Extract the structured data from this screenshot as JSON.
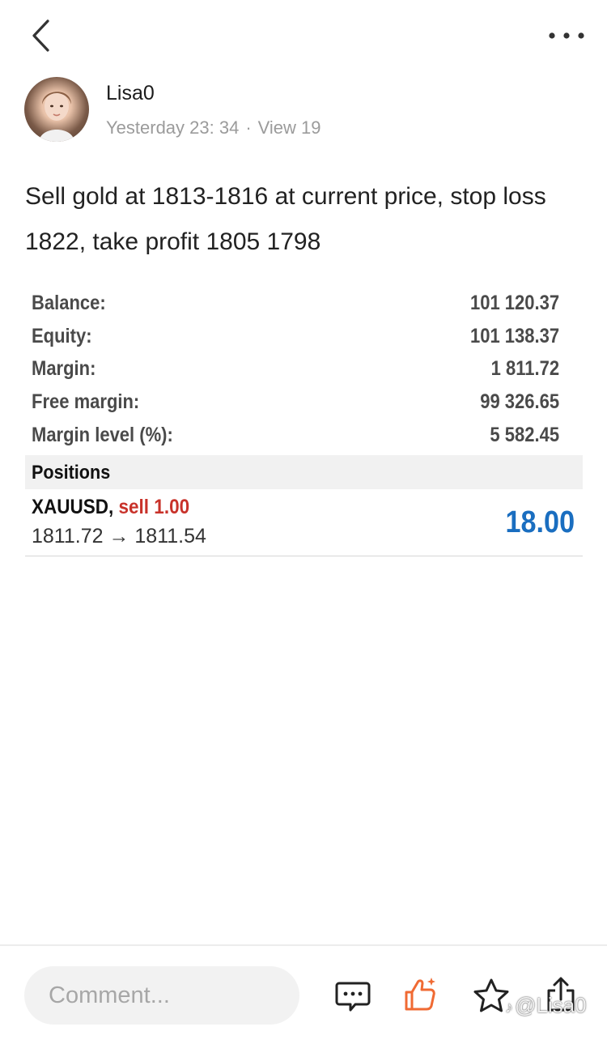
{
  "author": {
    "name": "Lisa0",
    "time": "Yesterday 23: 34",
    "separator": "·",
    "views": "View 19"
  },
  "post": {
    "text": "Sell gold at 1813-1816 at current price, stop loss 1822, take profit 1805 1798"
  },
  "account": {
    "rows": [
      {
        "label": "Balance:",
        "value": "101 120.37"
      },
      {
        "label": "Equity:",
        "value": "101 138.37"
      },
      {
        "label": "Margin:",
        "value": "1 811.72"
      },
      {
        "label": "Free margin:",
        "value": "99 326.65"
      },
      {
        "label": "Margin level (%):",
        "value": "5 582.45"
      }
    ]
  },
  "positions": {
    "header": "Positions",
    "items": [
      {
        "symbol": "XAUUSD,",
        "side": "sell 1.00",
        "prices": "1811.72 → 1811.54",
        "profit": "18.00"
      }
    ]
  },
  "bottom_bar": {
    "comment_placeholder": "Comment...",
    "watermark": "@Lisa0"
  },
  "colors": {
    "sell": "#c8322a",
    "profit": "#1a6ec0",
    "like_accent": "#f06a33"
  },
  "icons": [
    "back-chevron-icon",
    "more-dots-icon",
    "comment-icon",
    "like-icon",
    "star-icon",
    "share-icon"
  ]
}
